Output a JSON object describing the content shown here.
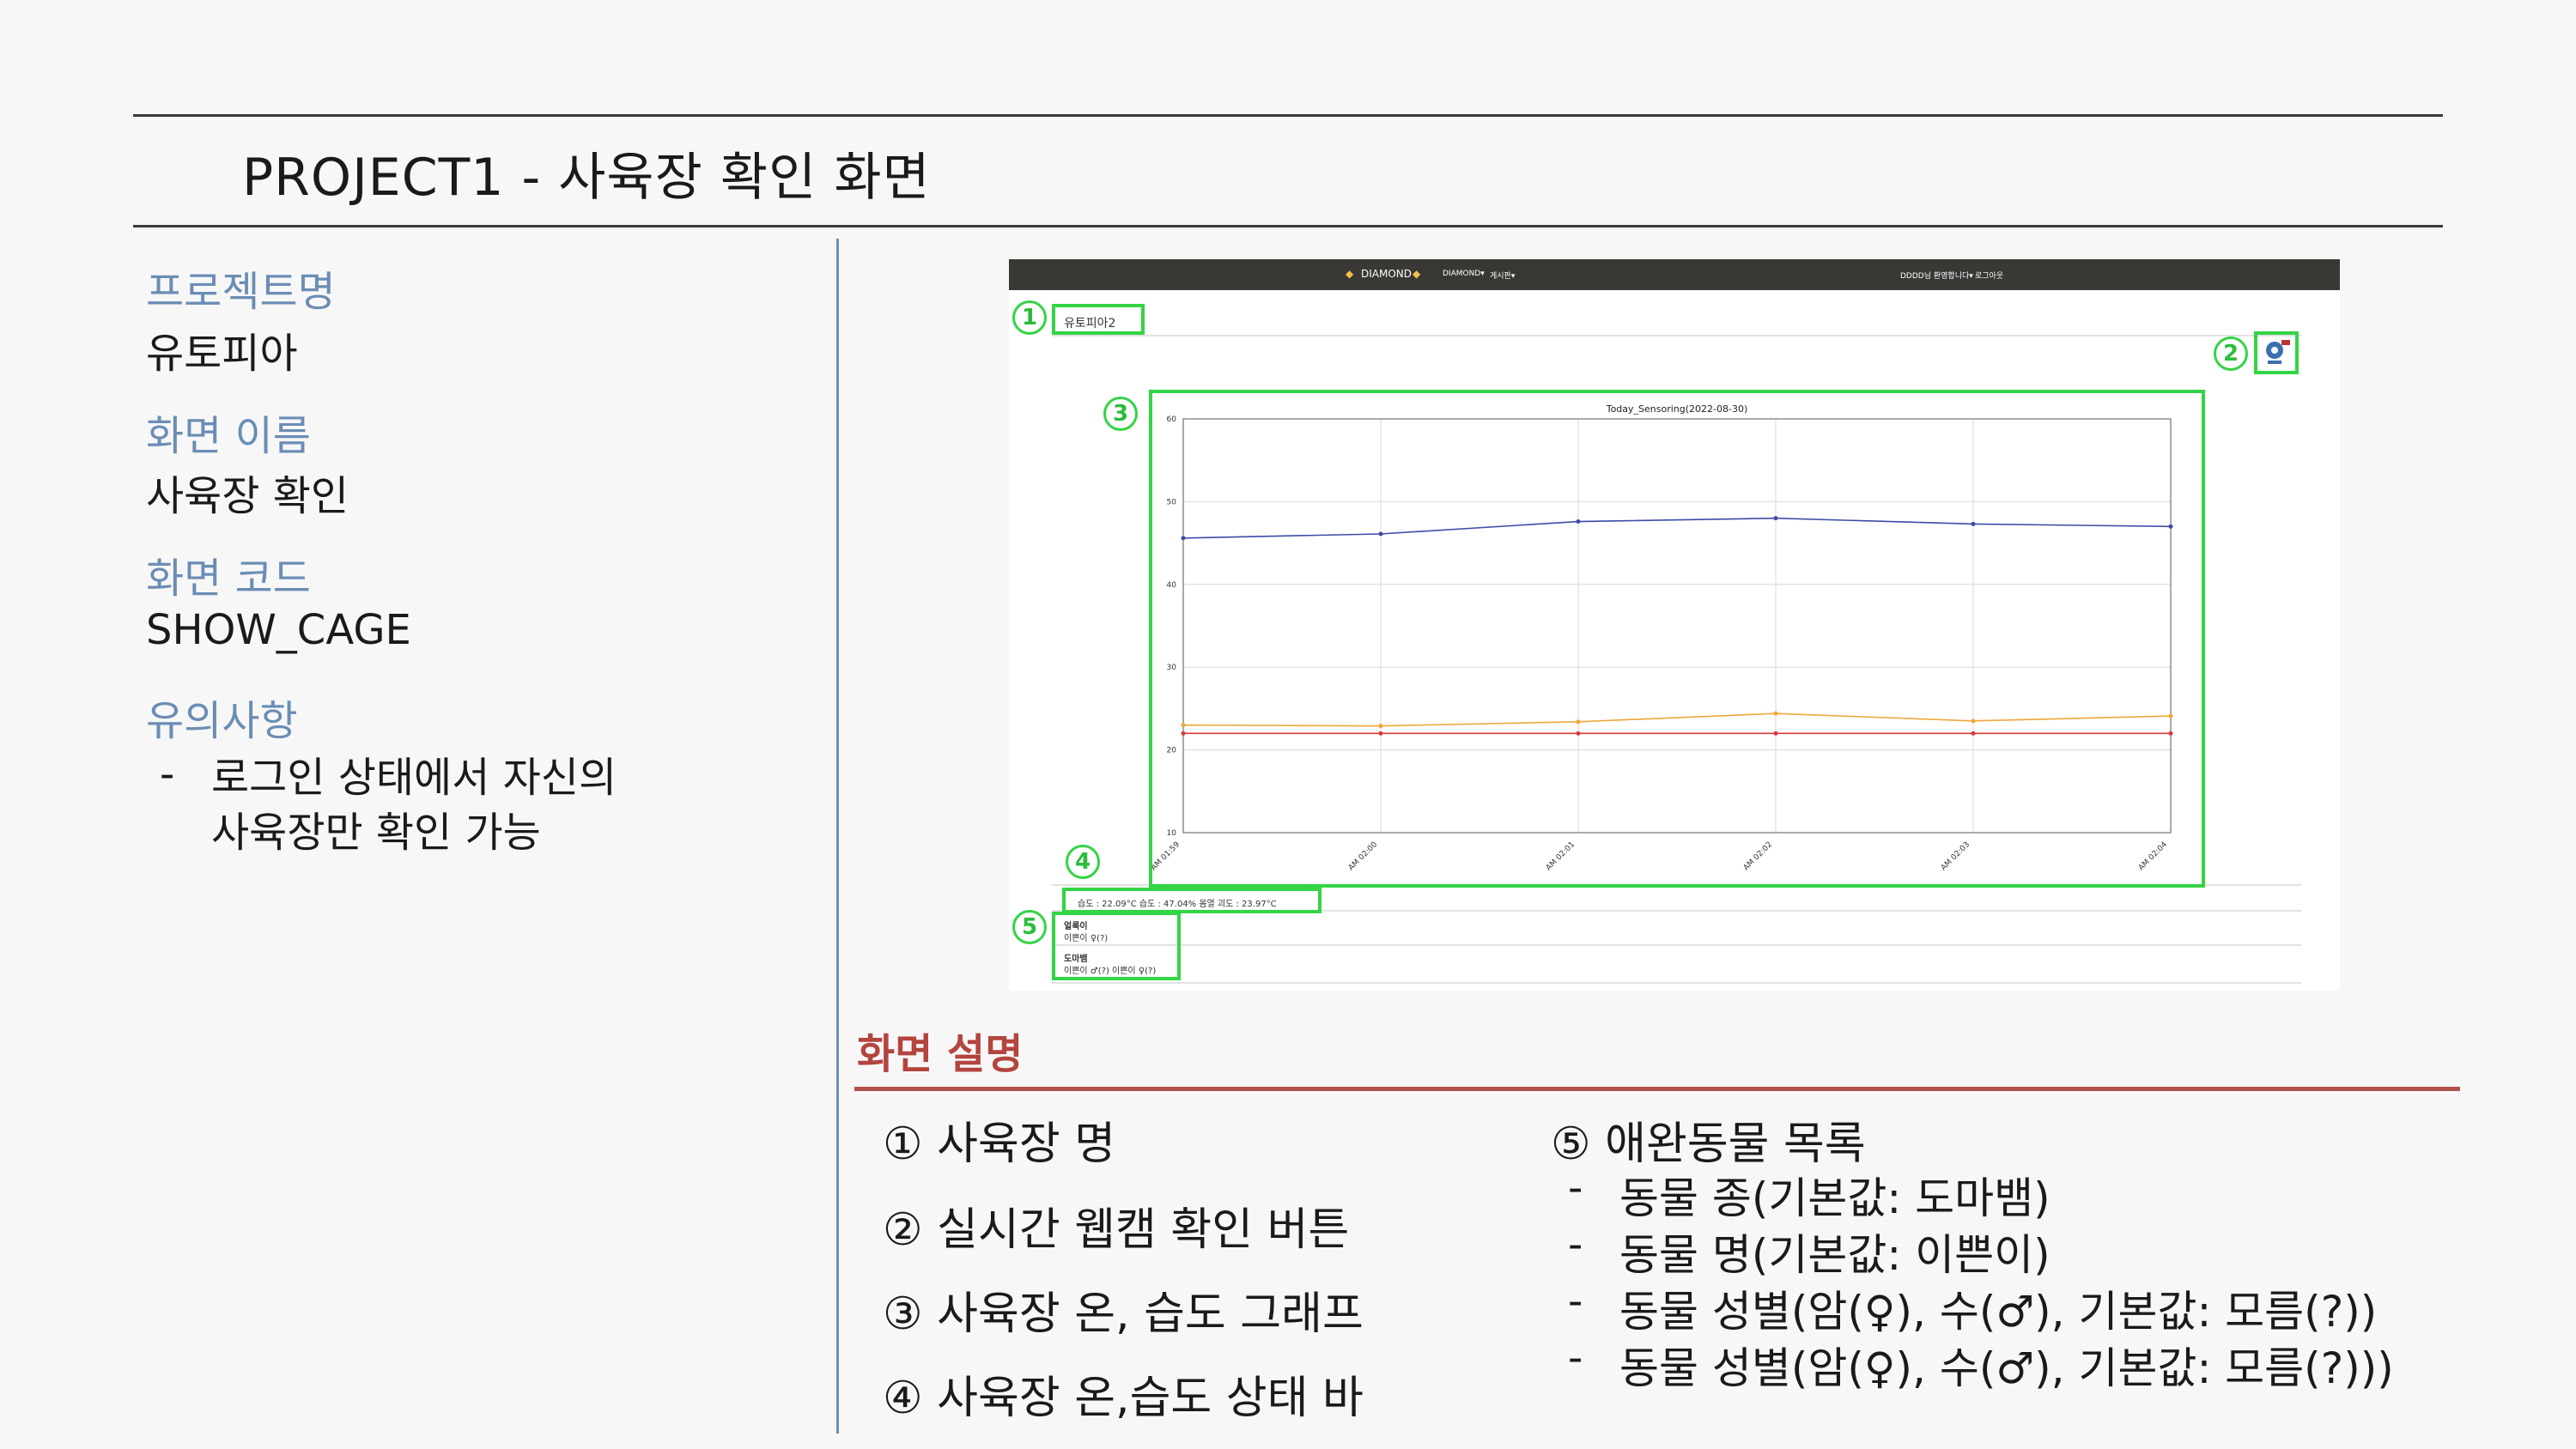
{
  "header": {
    "title": "PROJECT1 - 사육장 확인 화면"
  },
  "info": {
    "project_label": "프로젝트명",
    "project_value": "유토피아",
    "screen_name_label": "화면 이름",
    "screen_name_value": "사육장 확인",
    "screen_code_label": "화면 코드",
    "screen_code_value": "SHOW_CAGE",
    "notes_label": "유의사항",
    "notes_dash": "-",
    "notes": [
      "로그인 상태에서 자신의",
      "사육장만 확인 가능"
    ]
  },
  "screenshot": {
    "nav": {
      "brand": "DIAMOND",
      "menu1": "DIAMOND▾",
      "menu2": "게시판▾",
      "user": "DDDD님 환영합니다▾",
      "logout": "로그아웃"
    },
    "cage_name": "유토피아2",
    "webcam_icon": "webcam-icon",
    "status_bar": "습도 : 22.09°C   습도 : 47.04%   몸열 괴도 : 23.97°C",
    "pets": [
      {
        "species": "얼룩이",
        "name": "이쁜이 ♀(?)"
      },
      {
        "species": "도마뱀",
        "name": "이쁜이 ♂(?) 이쁜이 ♀(?)"
      }
    ],
    "callouts": [
      "1",
      "2",
      "3",
      "4",
      "5"
    ]
  },
  "description": {
    "title": "화면 설명",
    "items": [
      "① 사육장 명",
      "② 실시간 웹캠 확인 버튼",
      "③ 사육장 온, 습도 그래프",
      "④ 사육장 온,습도 상태 바"
    ],
    "right_heading": "⑤ 애완동물 목록",
    "right_items": [
      "동물 종(기본값: 도마뱀)",
      "동물 명(기본값: 이쁜이)",
      "동물 성별(암(♀), 수(♂), 기본값: 모름(?))",
      "동물 성별(암(♀), 수(♂), 기본값: 모름(?)))"
    ],
    "dash": "-"
  },
  "chart_data": {
    "type": "line",
    "title": "Today_Sensoring(2022-08-30)",
    "categories": [
      "AM 01:59",
      "AM 02:00",
      "AM 02:01",
      "AM 02:02",
      "AM 02:03",
      "AM 02:04"
    ],
    "series": [
      {
        "color": "#3b4ca8",
        "values": [
          45.6,
          46.1,
          47.6,
          48.0,
          47.3,
          47.0
        ]
      },
      {
        "color": "#f0a63a",
        "values": [
          23.0,
          22.9,
          23.4,
          24.4,
          23.5,
          24.1
        ]
      },
      {
        "color": "#d63a3a",
        "values": [
          22.0,
          22.0,
          22.0,
          22.0,
          22.0,
          22.0
        ]
      }
    ],
    "ylim": [
      10,
      60
    ],
    "yticks": [
      10,
      20,
      30,
      40,
      50,
      60
    ],
    "grid": true,
    "colors": {
      "accent": "#33d445",
      "title": "#b3443e",
      "label": "#6b8db4"
    }
  }
}
